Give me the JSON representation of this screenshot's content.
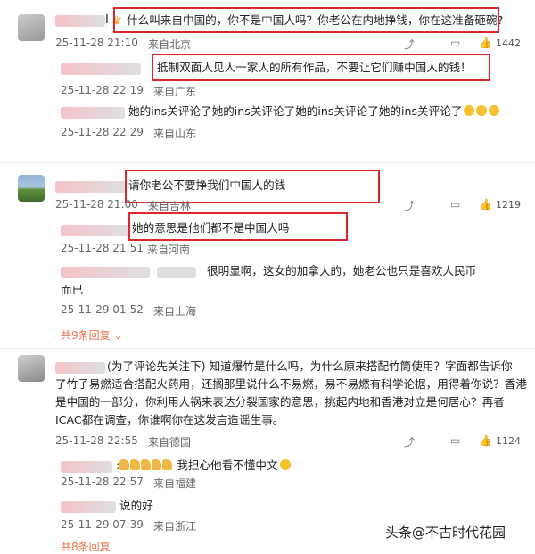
{
  "comments": [
    {
      "id": "c1",
      "name_suffix": "I",
      "text": "什么叫来自中国的，你不是中国人吗？你老公在内地挣钱，你在这准备砸碗?",
      "time": "25-11-28 21:10",
      "location": "来自北京",
      "likes": "1442",
      "replies": [
        {
          "text": "抵制双面人见人一家人的所有作品，不要让它们赚中国人的钱！",
          "time": "25-11-28 22:19",
          "location": "来自广东"
        },
        {
          "text": "她的ins关评论了她的ins关评论了她的ins关评论了她的ins关评论了",
          "time": "25-11-28 22:29",
          "location": "来自山东"
        }
      ]
    },
    {
      "id": "c2",
      "text": "请你老公不要挣我们中国人的钱",
      "time": "25-11-28 21:00",
      "location": "来自吉林",
      "likes": "1219",
      "replies": [
        {
          "text": "她的意思是他们都不是中国人吗",
          "time": "25-11-28 21:51",
          "location": "来自河南"
        },
        {
          "text": "很明显啊，这女的加拿大的，她老公也只是喜欢人民币",
          "text2": "而已",
          "time": "25-11-29 01:52",
          "location": "来自上海"
        }
      ],
      "more": "共9条回复"
    },
    {
      "id": "c3",
      "lines": [
        "(为了评论先关注下)  知道爆竹是什么吗，为什么原来搭配竹筒使用？字面都告诉你",
        "了竹子易燃适合搭配火药用，还搁那里说什么不易燃，易不易燃有科学论据，用得着你说？香港",
        "是中国的一部分，你利用人祸来表达分裂国家的意思，挑起内地和香港对立是何居心？再者",
        "ICAC都在调查，你谁啊你在这发言造谣生事。"
      ],
      "time": "25-11-28 22:55",
      "location": "来自德国",
      "likes": "1124",
      "replies": [
        {
          "text": "我担心他看不懂中文",
          "time": "25-11-28 22:57",
          "location": "来自福建"
        },
        {
          "text": "说的好",
          "time": "25-11-29 07:39",
          "location": "来自浙江"
        }
      ],
      "more": "共8条回复"
    }
  ],
  "watermark": "头条@不古时代花园",
  "colors": {
    "highlight": "#e0252e",
    "more_link": "#eb7350"
  }
}
